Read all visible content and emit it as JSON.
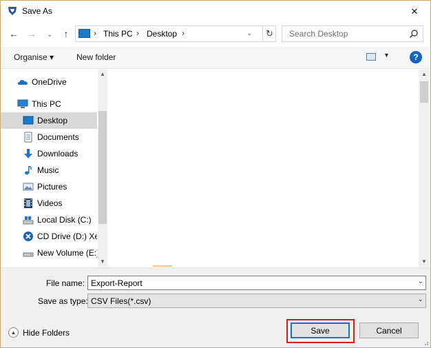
{
  "window": {
    "title": "Save As",
    "close_glyph": "✕"
  },
  "nav": {
    "back_glyph": "←",
    "forward_glyph": "→",
    "recent_glyph": "⌄",
    "up_glyph": "↑",
    "address": {
      "items": [
        "This PC",
        "Desktop"
      ],
      "separator": "›",
      "refresh_glyph": "↻"
    },
    "search": {
      "placeholder": "Search Desktop"
    }
  },
  "toolbar": {
    "organise_label": "Organise ▾",
    "new_folder_label": "New folder",
    "view_caret": "▼",
    "help_label": "?"
  },
  "tree": {
    "items": [
      {
        "label": "OneDrive",
        "icon": "onedrive-icon",
        "indent": 1
      },
      {
        "label": "This PC",
        "icon": "this-pc-icon",
        "indent": 1
      },
      {
        "label": "Desktop",
        "icon": "desktop-icon",
        "indent": 2,
        "selected": true
      },
      {
        "label": "Documents",
        "icon": "documents-icon",
        "indent": 2
      },
      {
        "label": "Downloads",
        "icon": "downloads-icon",
        "indent": 2
      },
      {
        "label": "Music",
        "icon": "music-icon",
        "indent": 2
      },
      {
        "label": "Pictures",
        "icon": "pictures-icon",
        "indent": 2
      },
      {
        "label": "Videos",
        "icon": "videos-icon",
        "indent": 2
      },
      {
        "label": "Local Disk (C:)",
        "icon": "local-disk-icon",
        "indent": 2
      },
      {
        "label": "CD Drive (D:) Xen",
        "icon": "cd-drive-icon",
        "indent": 2
      },
      {
        "label": "New Volume (E:)",
        "icon": "new-volume-icon",
        "indent": 2
      }
    ]
  },
  "form": {
    "file_name_label": "File name:",
    "file_name_value": "Export-Report",
    "save_as_type_label": "Save as type:",
    "save_as_type_value": "CSV Files(*.csv)"
  },
  "footer": {
    "hide_folders_label": "Hide Folders",
    "save_label": "Save",
    "cancel_label": "Cancel"
  },
  "colors": {
    "accent": "#0078d7",
    "highlight_outline": "#d81c1c",
    "selected_row": "#d9d9d9"
  }
}
